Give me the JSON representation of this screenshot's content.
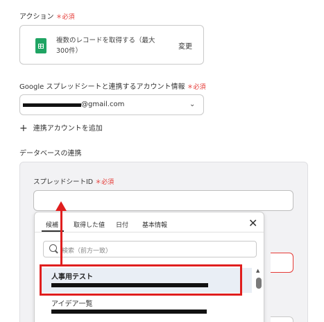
{
  "action": {
    "label": "アクション",
    "required": "＊必須",
    "icon": "google-sheets-icon",
    "text": "複数のレコードを取得する（最大300件）",
    "change_label": "変更"
  },
  "account": {
    "label": "Google スプレッドシートと連携するアカウント情報",
    "required": "＊必須",
    "email_suffix": "@gmail.com",
    "add_label": "連携アカウントを追加"
  },
  "database": {
    "section_label": "データベースの連携",
    "spreadsheet_id_label": "スプレッドシートID",
    "required": "＊必須"
  },
  "dropdown": {
    "tabs": [
      {
        "label": "候補"
      },
      {
        "label": "取得した値"
      },
      {
        "label": "日付"
      },
      {
        "label": "基本情報"
      }
    ],
    "search_placeholder": "検索（前方一致）",
    "items": [
      {
        "title": "人事用テスト"
      },
      {
        "title": "アイデア一覧"
      }
    ]
  },
  "colors": {
    "accent_red": "#e01e1e",
    "required_red": "#e53935",
    "sheets_green": "#1fa463"
  }
}
